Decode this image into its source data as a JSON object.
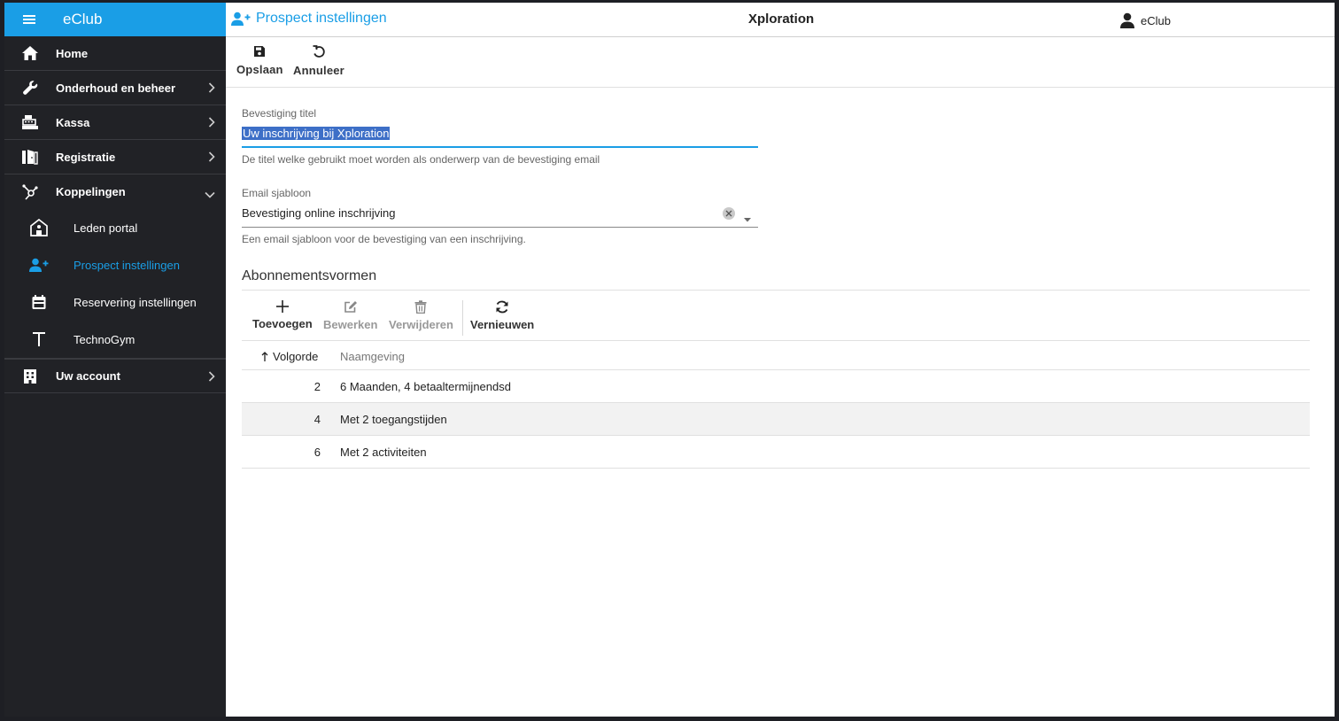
{
  "app": {
    "brand": "eClub",
    "title": "Xploration",
    "user": "eClub"
  },
  "header": {
    "page_title": "Prospect instellingen"
  },
  "sidebar": {
    "items": [
      {
        "label": "Home"
      },
      {
        "label": "Onderhoud en beheer"
      },
      {
        "label": "Kassa"
      },
      {
        "label": "Registratie"
      },
      {
        "label": "Koppelingen"
      }
    ],
    "sub_items": [
      {
        "label": "Leden portal"
      },
      {
        "label": "Prospect instellingen"
      },
      {
        "label": "Reservering instellingen"
      },
      {
        "label": "TechnoGym"
      }
    ],
    "account": {
      "label": "Uw account"
    }
  },
  "toolbar": {
    "save_label": "Opslaan",
    "cancel_label": "Annuleer"
  },
  "form": {
    "title_field": {
      "label": "Bevestiging titel",
      "value": "Uw inschrijving bij Xploration",
      "hint": "De titel welke gebruikt moet worden als onderwerp van de bevestiging email"
    },
    "template_field": {
      "label": "Email sjabloon",
      "value": "Bevestiging online inschrijving",
      "hint": "Een email sjabloon voor de bevestiging van een inschrijving."
    }
  },
  "subscriptions": {
    "title": "Abonnementsvormen",
    "toolbar": {
      "add": "Toevoegen",
      "edit": "Bewerken",
      "delete": "Verwijderen",
      "refresh": "Vernieuwen"
    },
    "columns": [
      "Volgorde",
      "Naamgeving"
    ],
    "rows": [
      {
        "order": "2",
        "name": "6 Maanden, 4 betaaltermijnendsd"
      },
      {
        "order": "4",
        "name": "Met 2 toegangstijden"
      },
      {
        "order": "6",
        "name": "Met 2 activiteiten"
      }
    ]
  },
  "colors": {
    "accent": "#1a9ee6",
    "sidebar": "#212226"
  }
}
